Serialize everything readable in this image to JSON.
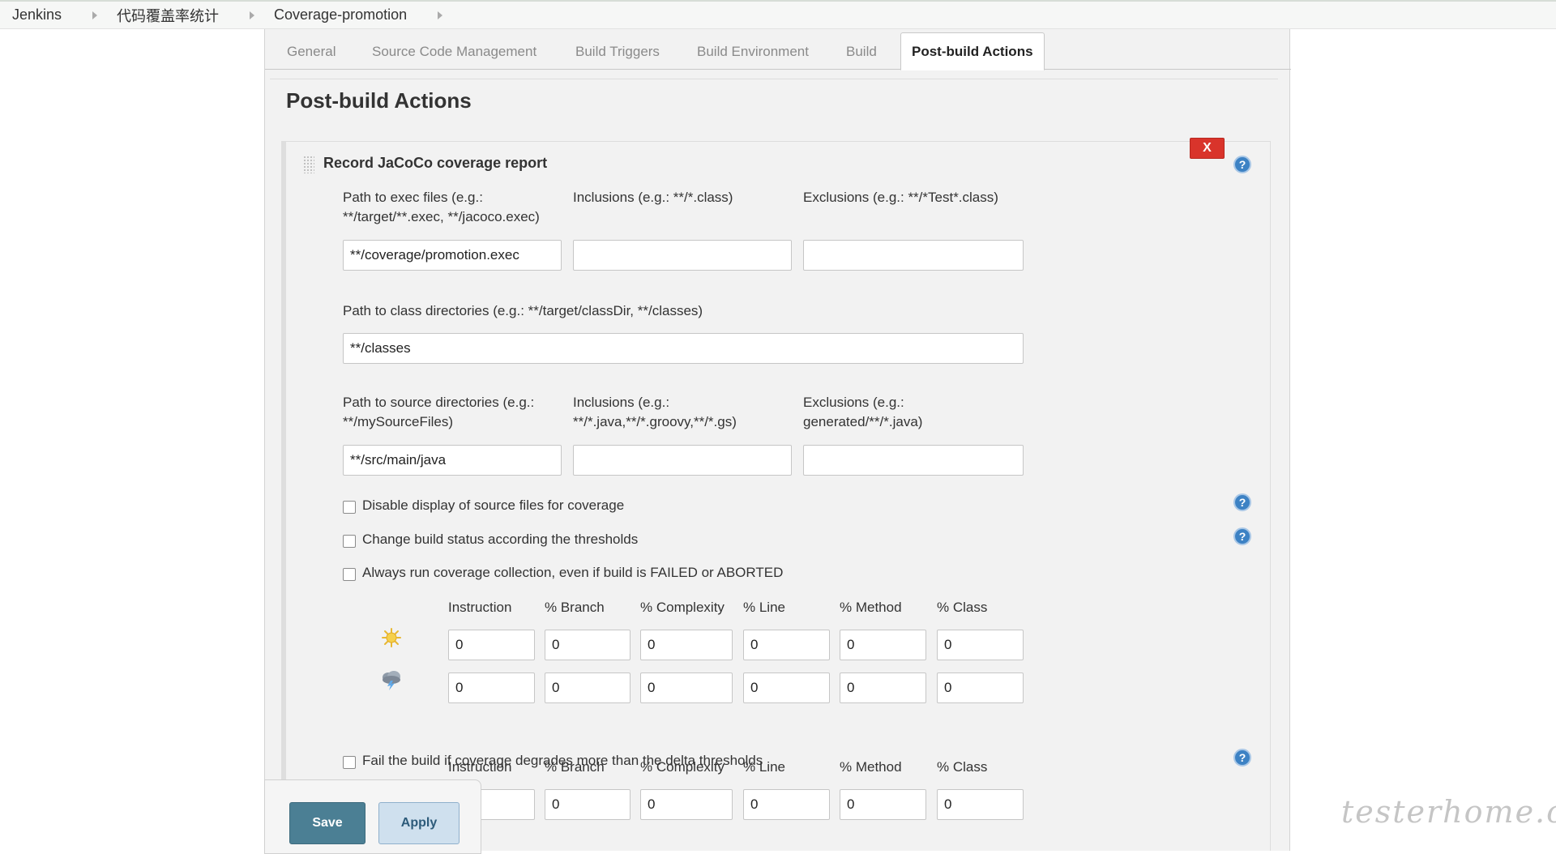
{
  "breadcrumb": [
    "Jenkins",
    "代码覆盖率统计",
    "Coverage-promotion"
  ],
  "tabs": [
    "General",
    "Source Code Management",
    "Build Triggers",
    "Build Environment",
    "Build",
    "Post-build Actions"
  ],
  "active_tab": "Post-build Actions",
  "section_title": "Post-build Actions",
  "action": {
    "title": "Record JaCoCo coverage report",
    "delete_label": "X",
    "help_label": "?",
    "exec_label_1": "Path to exec files (e.g.:",
    "exec_label_2": "**/target/**.exec, **/jacoco.exec)",
    "exec_value": "**/coverage/promotion.exec",
    "inclusions_label": "Inclusions (e.g.: **/*.class)",
    "inclusions_value": "",
    "exclusions_label": "Exclusions (e.g.: **/*Test*.class)",
    "exclusions_value": "",
    "class_dir_label": "Path to class directories (e.g.: **/target/classDir, **/classes)",
    "class_dir_value": "**/classes",
    "source_label_1": "Path to source directories (e.g.:",
    "source_label_2": "**/mySourceFiles)",
    "source_value": "**/src/main/java",
    "src_incl_label_1": "Inclusions (e.g.:",
    "src_incl_label_2": "**/*.java,**/*.groovy,**/*.gs)",
    "src_incl_value": "",
    "src_excl_label_1": "Exclusions (e.g.:",
    "src_excl_label_2": "generated/**/*.java)",
    "src_excl_value": "",
    "checkboxes": [
      "Disable display of source files for coverage",
      "Change build status according the thresholds",
      "Always run coverage collection, even if build is FAILED or ABORTED"
    ],
    "threshold_headers": [
      "Instruction",
      "% Branch",
      "% Complexity",
      "% Line",
      "% Method",
      "% Class"
    ],
    "healthy_values": [
      "0",
      "0",
      "0",
      "0",
      "0",
      "0"
    ],
    "unhealthy_values": [
      "0",
      "0",
      "0",
      "0",
      "0",
      "0"
    ],
    "delta_checkbox": "Fail the build if coverage degrades more than the delta thresholds",
    "delta_headers": [
      "Instruction",
      "% Branch",
      "% Complexity",
      "% Line",
      "% Method",
      "% Class"
    ],
    "delta_values": [
      "",
      "0",
      "0",
      "0",
      "0",
      "0"
    ]
  },
  "buttons": {
    "save": "Save",
    "apply": "Apply"
  },
  "watermark": "testerhome.com",
  "colors": {
    "delete": "#d9342b",
    "save": "#4b7f94",
    "apply": "#cfe0ee",
    "help": "#3d82c4"
  }
}
